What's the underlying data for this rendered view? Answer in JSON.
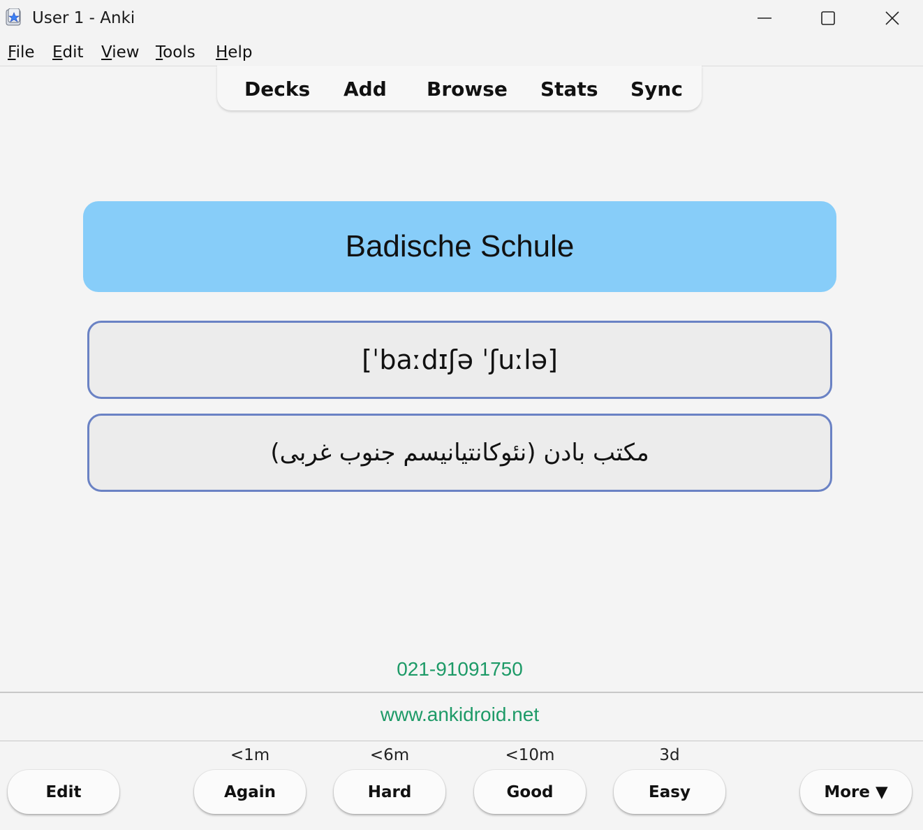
{
  "window": {
    "title": "User 1 - Anki",
    "controls": [
      "minimize-icon",
      "maximize-icon",
      "close-icon"
    ]
  },
  "menu": [
    {
      "accel": "F",
      "rest": "ile"
    },
    {
      "accel": "E",
      "rest": "dit"
    },
    {
      "accel": "V",
      "rest": "iew"
    },
    {
      "accel": "T",
      "rest": "ools"
    },
    {
      "accel": "H",
      "rest": "elp"
    }
  ],
  "toolbar": {
    "decks": "Decks",
    "add": "Add",
    "browse": "Browse",
    "stats": "Stats",
    "sync": "Sync"
  },
  "card": {
    "front": "Badische Schule",
    "ipa": "[ˈbaːdɪʃə ˈʃuːlə]",
    "translation": "مکتب بادن (نئوکانتیانیسم جنوب غربی)",
    "phone": "021-91091750",
    "website": "www.ankidroid.net"
  },
  "colors": {
    "front_bg": "#87cdf9",
    "box_border": "#6a82c4",
    "link_green": "#1d9a67"
  },
  "bottom": {
    "edit": "Edit",
    "again": {
      "label": "Again",
      "interval": "<1m"
    },
    "hard": {
      "label": "Hard",
      "interval": "<6m"
    },
    "good": {
      "label": "Good",
      "interval": "<10m"
    },
    "easy": {
      "label": "Easy",
      "interval": "3d"
    },
    "more": "More ▼"
  }
}
